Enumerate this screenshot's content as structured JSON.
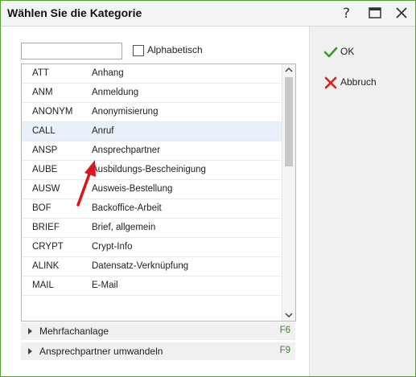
{
  "window": {
    "title": "Wählen Sie die Kategorie",
    "help_icon": "question-mark-icon",
    "maximize_icon": "maximize-icon",
    "close_icon": "close-icon"
  },
  "filter": {
    "search_value": "",
    "alphabetical_label": "Alphabetisch",
    "alphabetical_checked": false
  },
  "categories": [
    {
      "code": "ATT",
      "name": "Anhang"
    },
    {
      "code": "ANM",
      "name": "Anmeldung"
    },
    {
      "code": "ANONYM",
      "name": "Anonymisierung"
    },
    {
      "code": "CALL",
      "name": "Anruf",
      "selected": true
    },
    {
      "code": "ANSP",
      "name": "Ansprechpartner"
    },
    {
      "code": "AUBE",
      "name": "Ausbildungs-Bescheinigung"
    },
    {
      "code": "AUSW",
      "name": "Ausweis-Bestellung"
    },
    {
      "code": "BOF",
      "name": "Backoffice-Arbeit"
    },
    {
      "code": "BRIEF",
      "name": "Brief, allgemein"
    },
    {
      "code": "CRYPT",
      "name": "Crypt-Info"
    },
    {
      "code": "ALINK",
      "name": "Datensatz-Verknüpfung"
    },
    {
      "code": "MAIL",
      "name": "E-Mail"
    }
  ],
  "expanders": [
    {
      "label": "Mehrfachanlage",
      "key": "F6"
    },
    {
      "label": "Ansprechpartner umwandeln",
      "key": "F9"
    }
  ],
  "actions": {
    "ok_label": "OK",
    "ok_icon": "checkmark-icon",
    "cancel_label": "Abbruch",
    "cancel_icon": "red-x-icon"
  },
  "colors": {
    "accent_green": "#3a8a28",
    "cancel_red": "#d92020",
    "selected_row": "#e8f0fa",
    "annotation_arrow": "#e0141e"
  }
}
